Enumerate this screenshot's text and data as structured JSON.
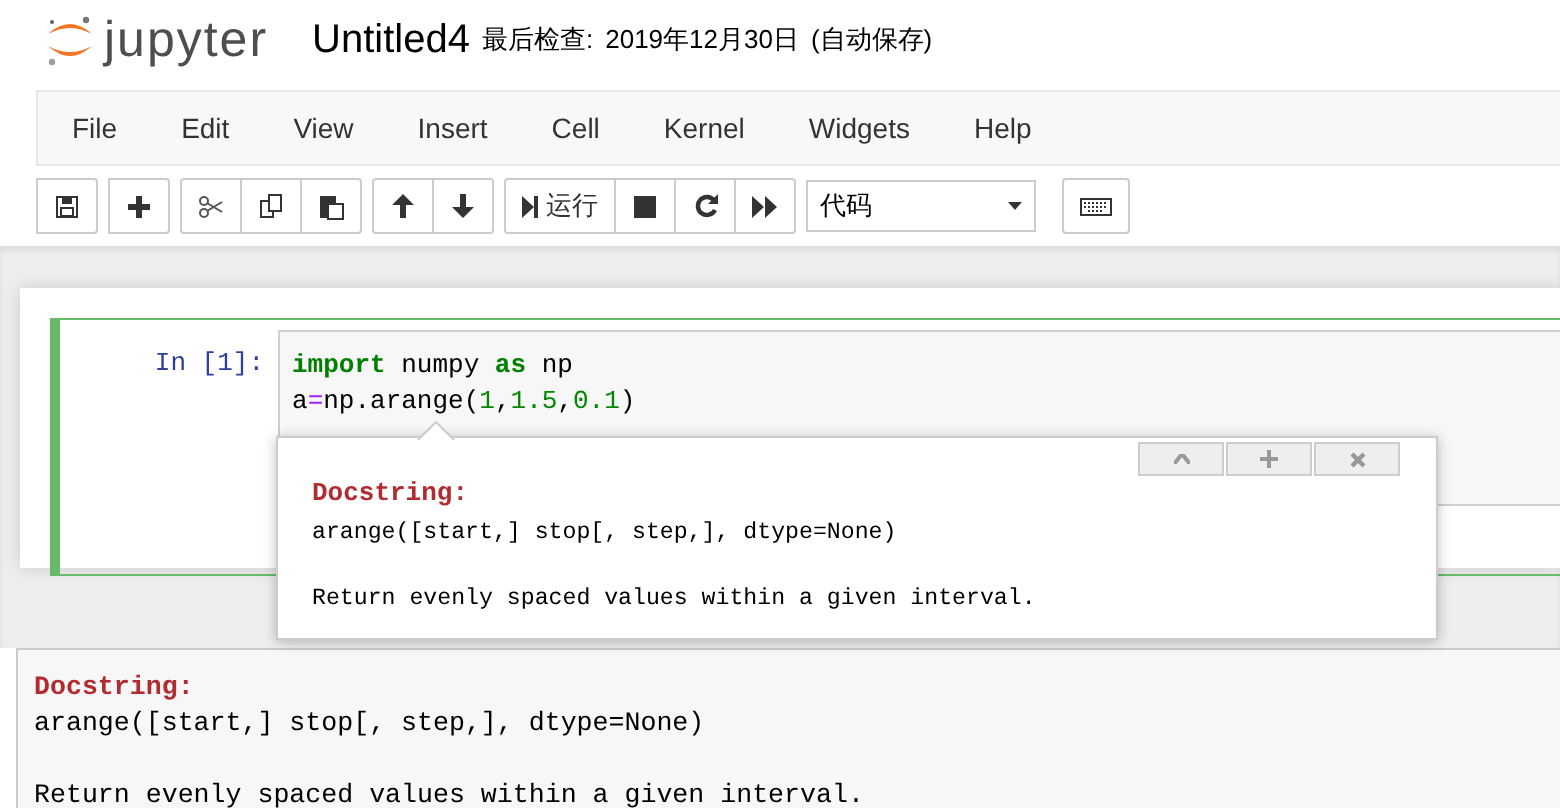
{
  "header": {
    "logo_text": "jupyter",
    "notebook_name": "Untitled4",
    "checkpoint_label": "最后检查:",
    "checkpoint_date": "2019年12月30日",
    "autosave_status": "(自动保存)"
  },
  "menu": [
    "File",
    "Edit",
    "View",
    "Insert",
    "Cell",
    "Kernel",
    "Widgets",
    "Help"
  ],
  "toolbar": {
    "run_label": "运行",
    "cell_type": "代码"
  },
  "cell": {
    "prompt": "In [1]:",
    "selected": true,
    "lines": [
      [
        {
          "kind": "keyword",
          "text": "import"
        },
        {
          "kind": "plain",
          "text": " numpy "
        },
        {
          "kind": "keyword",
          "text": "as"
        },
        {
          "kind": "plain",
          "text": " np"
        }
      ],
      [
        {
          "kind": "plain",
          "text": "a"
        },
        {
          "kind": "operator",
          "text": "="
        },
        {
          "kind": "plain",
          "text": "np.arange("
        },
        {
          "kind": "number",
          "text": "1"
        },
        {
          "kind": "plain",
          "text": ","
        },
        {
          "kind": "number",
          "text": "1.5"
        },
        {
          "kind": "plain",
          "text": ","
        },
        {
          "kind": "number",
          "text": "0.1"
        },
        {
          "kind": "plain",
          "text": ")"
        }
      ]
    ]
  },
  "tooltip": {
    "title": "Docstring:",
    "signature": "arange([start,] stop[, step,], dtype=None)",
    "description": "Return evenly spaced values within a given interval."
  },
  "pager": {
    "title": "Docstring:",
    "signature": "arange([start,] stop[, step,], dtype=None)",
    "description": "Return evenly spaced values within a given interval."
  }
}
